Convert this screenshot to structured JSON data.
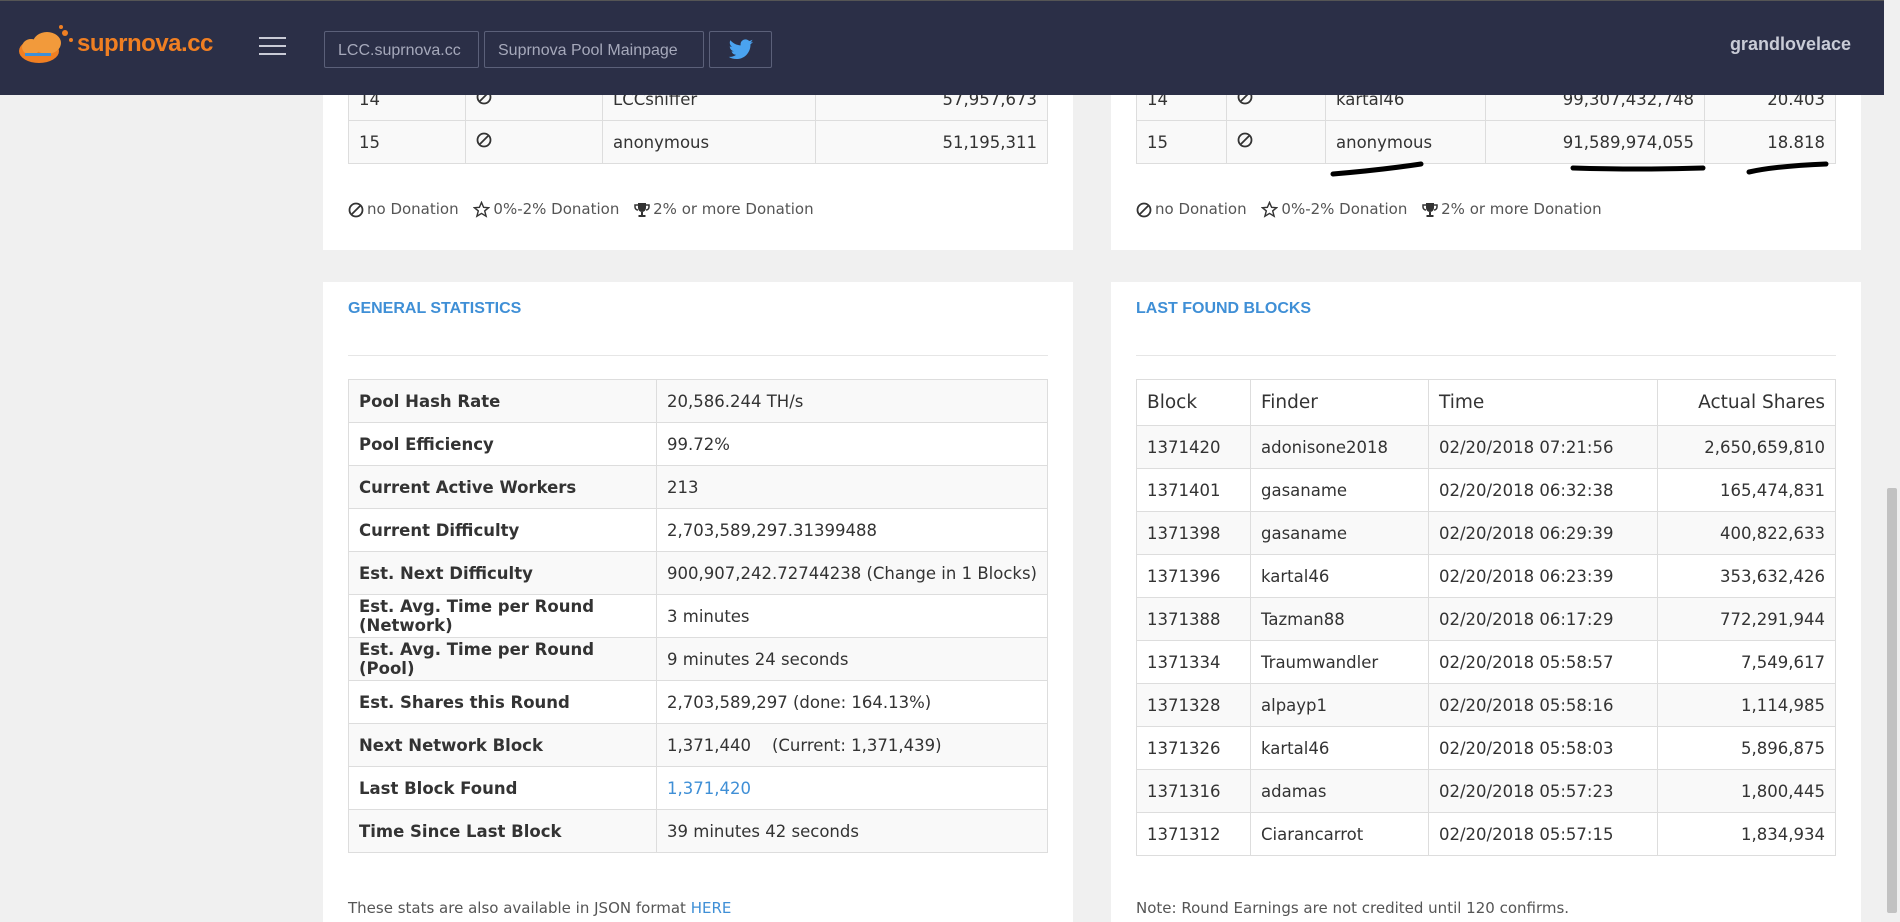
{
  "navbar": {
    "logo_text": "suprnova.cc",
    "buttons": [
      "LCC.suprnova.cc",
      "Suprnova Pool Mainpage"
    ],
    "twitter_label": "",
    "username": "grandlovelace"
  },
  "left_top": {
    "rows": [
      {
        "rank": "14",
        "name": "LCCsniffer",
        "shares": "57,957,673"
      },
      {
        "rank": "15",
        "name": "anonymous",
        "shares": "51,195,311"
      }
    ]
  },
  "right_top": {
    "rows": [
      {
        "rank": "14",
        "name": "kartal46",
        "shares": "99,307,432,748",
        "pct": "20.403"
      },
      {
        "rank": "15",
        "name": "anonymous",
        "shares": "91,589,974,055",
        "pct": "18.818"
      }
    ]
  },
  "legend": {
    "no_donation": "no Donation",
    "low_donation": "0%-2% Donation",
    "high_donation": "2% or more Donation"
  },
  "general_statistics": {
    "title": "GENERAL STATISTICS",
    "rows": [
      {
        "label": "Pool Hash Rate",
        "value": "20,586.244 TH/s"
      },
      {
        "label": "Pool Efficiency",
        "value": "99.72%"
      },
      {
        "label": "Current Active Workers",
        "value": "213"
      },
      {
        "label": "Current Difficulty",
        "value": "2,703,589,297.31399488"
      },
      {
        "label": "Est. Next Difficulty",
        "value": "900,907,242.72744238 (Change in 1 Blocks)"
      },
      {
        "label": "Est. Avg. Time per Round (Network)",
        "value": "3 minutes"
      },
      {
        "label": "Est. Avg. Time per Round (Pool)",
        "value": "9 minutes 24 seconds"
      },
      {
        "label": "Est. Shares this Round",
        "value": "2,703,589,297 (done: 164.13%)"
      },
      {
        "label": "Next Network Block",
        "value": "1,371,440    (Current: 1,371,439)"
      },
      {
        "label": "Last Block Found",
        "value": "1,371,420"
      },
      {
        "label": "Time Since Last Block",
        "value": "39 minutes 42 seconds"
      }
    ],
    "footnote_prefix": "These stats are also available in JSON format",
    "footnote_link": "HERE"
  },
  "last_found_blocks": {
    "title": "LAST FOUND BLOCKS",
    "headers": [
      "Block",
      "Finder",
      "Time",
      "Actual Shares"
    ],
    "rows": [
      {
        "block": "1371420",
        "finder": "adonisone2018",
        "time": "02/20/2018 07:21:56",
        "shares": "2,650,659,810"
      },
      {
        "block": "1371401",
        "finder": "gasaname",
        "time": "02/20/2018 06:32:38",
        "shares": "165,474,831"
      },
      {
        "block": "1371398",
        "finder": "gasaname",
        "time": "02/20/2018 06:29:39",
        "shares": "400,822,633"
      },
      {
        "block": "1371396",
        "finder": "kartal46",
        "time": "02/20/2018 06:23:39",
        "shares": "353,632,426"
      },
      {
        "block": "1371388",
        "finder": "Tazman88",
        "time": "02/20/2018 06:17:29",
        "shares": "772,291,944"
      },
      {
        "block": "1371334",
        "finder": "Traumwandler",
        "time": "02/20/2018 05:58:57",
        "shares": "7,549,617"
      },
      {
        "block": "1371328",
        "finder": "alpayp1",
        "time": "02/20/2018 05:58:16",
        "shares": "1,114,985"
      },
      {
        "block": "1371326",
        "finder": "kartal46",
        "time": "02/20/2018 05:58:03",
        "shares": "5,896,875"
      },
      {
        "block": "1371316",
        "finder": "adamas",
        "time": "02/20/2018 05:57:23",
        "shares": "1,800,445"
      },
      {
        "block": "1371312",
        "finder": "Ciarancarrot",
        "time": "02/20/2018 05:57:15",
        "shares": "1,834,934"
      }
    ],
    "footnote": "Note: Round Earnings are not credited until 120 confirms."
  },
  "colors": {
    "navbar_bg": "#2b2f47",
    "logo_orange": "#f07f22",
    "link_blue": "#3f8fd6",
    "annotation_black": "#000000"
  }
}
